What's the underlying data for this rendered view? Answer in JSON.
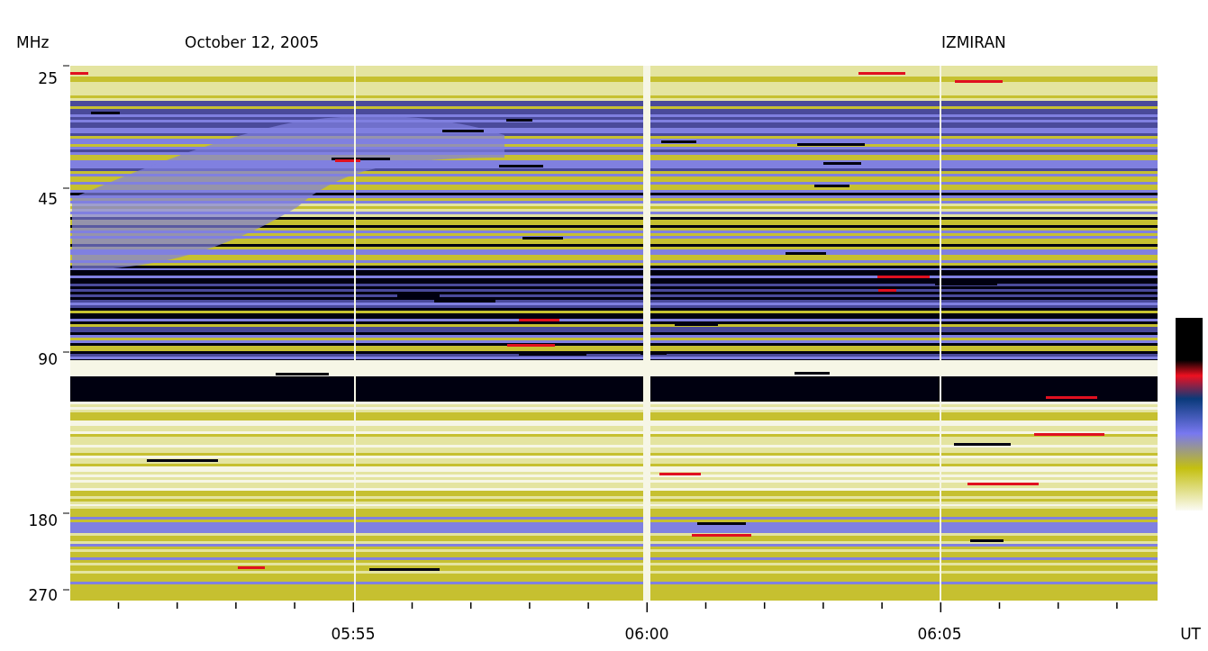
{
  "header": {
    "unit_label": "MHz",
    "date": "October 12, 2005",
    "observatory": "IZMIRAN"
  },
  "y_axis": {
    "labels": [
      "25",
      "45",
      "90",
      "180",
      "270"
    ]
  },
  "x_axis": {
    "labels": [
      "05:55",
      "06:00",
      "06:05"
    ],
    "unit": "UT"
  }
}
